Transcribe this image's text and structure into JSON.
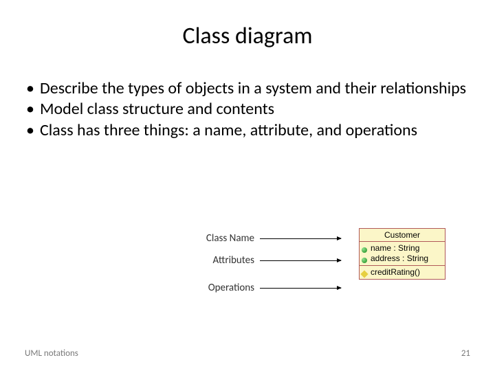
{
  "title": "Class diagram",
  "bullets": [
    "Describe the types of objects in a system and their relationships",
    "Model class structure and contents",
    "Class has three things: a name, attribute, and operations"
  ],
  "diagram": {
    "labels": {
      "className": "Class Name",
      "attributes": "Attributes",
      "operations": "Operations"
    },
    "uml": {
      "name": "Customer",
      "attributes": [
        "name : String",
        "address : String"
      ],
      "operations": [
        "creditRating()"
      ]
    }
  },
  "footer": {
    "left": "UML notations",
    "right": "21"
  }
}
